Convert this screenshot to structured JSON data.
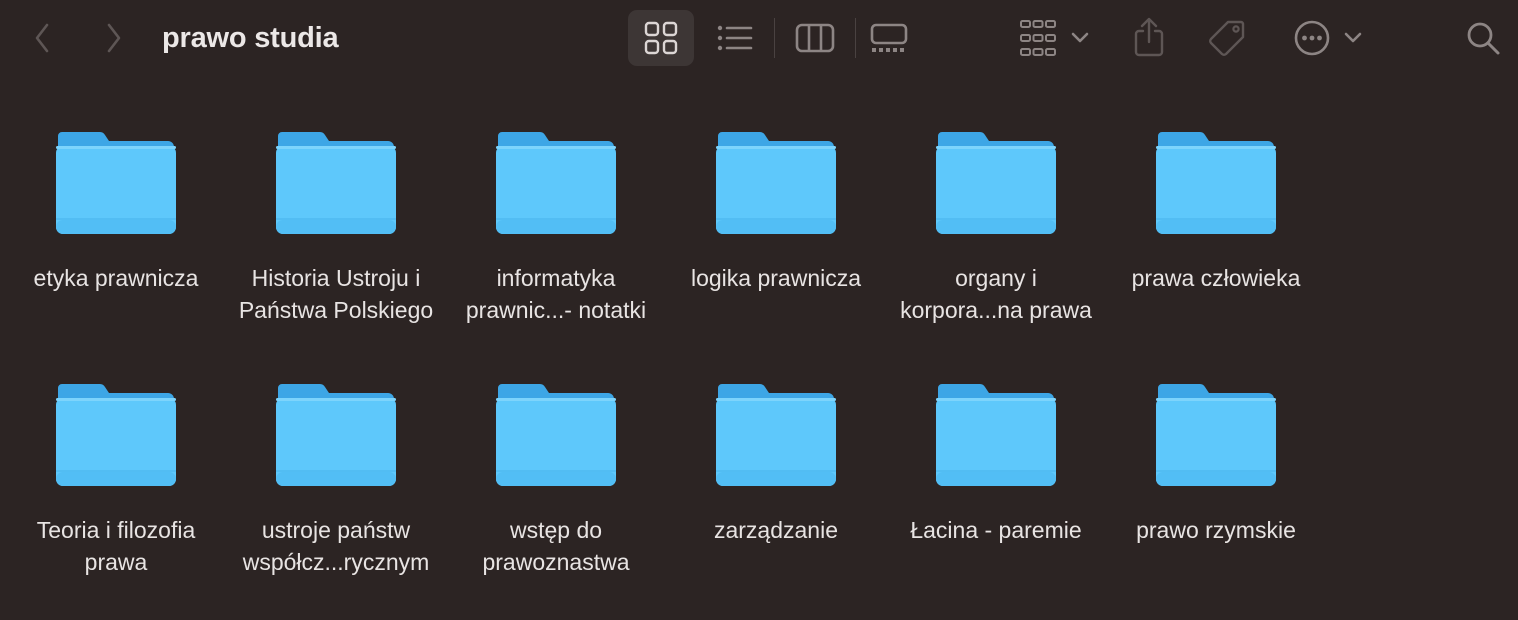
{
  "window": {
    "title": "prawo studia"
  },
  "toolbar": {
    "back_icon": "chevron-left-icon",
    "forward_icon": "chevron-right-icon",
    "views": [
      {
        "name": "icon-view",
        "active": true
      },
      {
        "name": "list-view",
        "active": false
      },
      {
        "name": "column-view",
        "active": false
      },
      {
        "name": "gallery-view",
        "active": false
      }
    ],
    "group_icon": "group-grid-icon",
    "share_icon": "share-icon",
    "tag_icon": "tag-icon",
    "more_icon": "ellipsis-circle-icon",
    "search_icon": "search-icon"
  },
  "colors": {
    "background": "#2c2423",
    "folder_body": "#5ec8fb",
    "folder_back": "#3da6e6",
    "text": "#e8e4e3",
    "icon_gray": "#8d8584"
  },
  "items": [
    {
      "line1": "etyka prawnicza",
      "line2": ""
    },
    {
      "line1": "Historia Ustroju i",
      "line2": "Państwa Polskiego"
    },
    {
      "line1": "informatyka",
      "line2": "prawnic...- notatki"
    },
    {
      "line1": "logika prawnicza",
      "line2": ""
    },
    {
      "line1": "organy i",
      "line2": "korpora...na prawa"
    },
    {
      "line1": "prawa człowieka",
      "line2": ""
    },
    {
      "line1": "Teoria i filozofia",
      "line2": "prawa"
    },
    {
      "line1": "ustroje państw",
      "line2": "współcz...rycznym"
    },
    {
      "line1": "wstęp do",
      "line2": "prawoznastwa"
    },
    {
      "line1": "zarządzanie",
      "line2": ""
    },
    {
      "line1": "Łacina - paremie",
      "line2": ""
    },
    {
      "line1": "prawo rzymskie",
      "line2": ""
    }
  ]
}
